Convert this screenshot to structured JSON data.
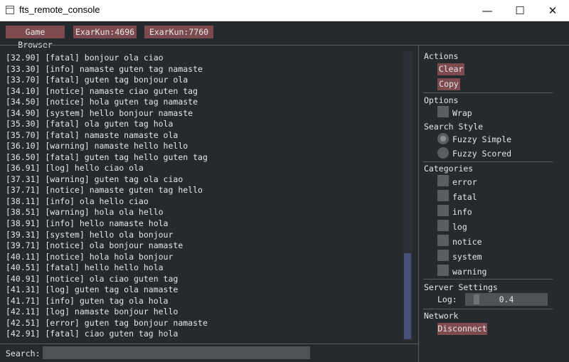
{
  "window": {
    "title": "fts_remote_console",
    "minimize_glyph": "—",
    "maximize_glyph": "☐",
    "close_glyph": "✕"
  },
  "tabs": [
    "Game Browser",
    "ExarKun:4696",
    "ExarKun:7760"
  ],
  "log_lines": [
    "[32.90] [fatal] bonjour ola ciao",
    "[33.30] [info] namaste guten tag namaste",
    "[33.70] [fatal] guten tag bonjour ola",
    "[34.10] [notice] namaste ciao guten tag",
    "[34.50] [notice] hola guten tag namaste",
    "[34.90] [system] hello bonjour namaste",
    "[35.30] [fatal] ola guten tag hola",
    "[35.70] [fatal] namaste namaste ola",
    "[36.10] [warning] namaste hello hello",
    "[36.50] [fatal] guten tag hello guten tag",
    "[36.91] [log] hello ciao ola",
    "[37.31] [warning] guten tag ola ciao",
    "[37.71] [notice] namaste guten tag hello",
    "[38.11] [info] ola hello ciao",
    "[38.51] [warning] hola ola hello",
    "[38.91] [info] hello namaste hola",
    "[39.31] [system] hello ola bonjour",
    "[39.71] [notice] ola bonjour namaste",
    "[40.11] [notice] hola hola bonjour",
    "[40.51] [fatal] hello hello hola",
    "[40.91] [notice] ola ciao guten tag",
    "[41.31] [log] guten tag ola namaste",
    "[41.71] [info] guten tag ola hola",
    "[42.11] [log] namaste bonjour hello",
    "[42.51] [error] guten tag bonjour namaste",
    "[42.91] [fatal] ciao guten tag hola"
  ],
  "search": {
    "label": "Search:",
    "value": ""
  },
  "actions": {
    "title": "Actions",
    "clear_label": "Clear",
    "copy_label": "Copy"
  },
  "options": {
    "title": "Options",
    "wrap_label": "Wrap",
    "wrap_checked": false
  },
  "search_style": {
    "title": "Search Style",
    "options": [
      "Fuzzy Simple",
      "Fuzzy Scored"
    ],
    "selected": "Fuzzy Simple"
  },
  "categories": {
    "title": "Categories",
    "items": [
      "error",
      "fatal",
      "info",
      "log",
      "notice",
      "system",
      "warning"
    ]
  },
  "server_settings": {
    "title": "Server Settings",
    "log_label": "Log:",
    "log_value": "0.4"
  },
  "network": {
    "title": "Network",
    "disconnect_label": "Disconnect"
  }
}
